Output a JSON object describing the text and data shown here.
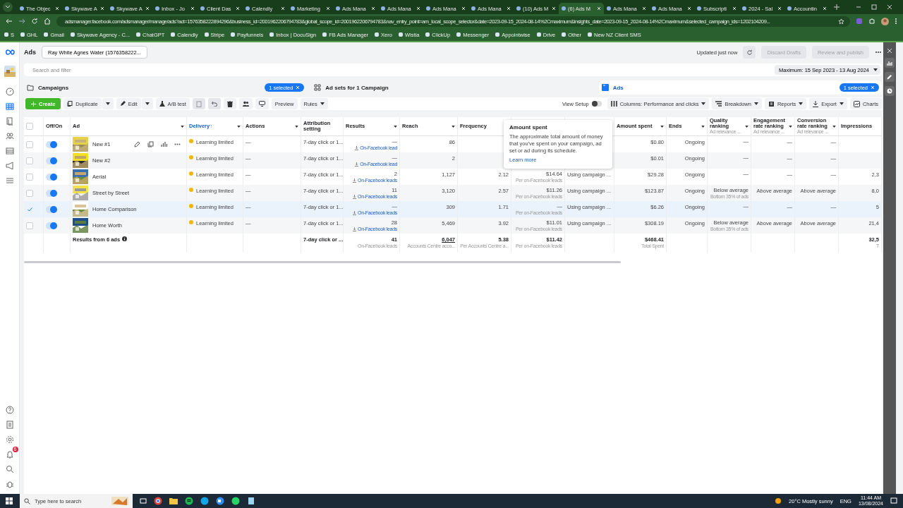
{
  "browser": {
    "tabs": [
      {
        "title": "The Objec",
        "selected": false
      },
      {
        "title": "Skywave A",
        "selected": false
      },
      {
        "title": "Skywave A",
        "selected": false
      },
      {
        "title": "Inbox - Jo",
        "selected": false
      },
      {
        "title": "Client Das",
        "selected": false
      },
      {
        "title": "Calendly",
        "selected": false
      },
      {
        "title": "Marketing",
        "selected": false
      },
      {
        "title": "Ads Mana",
        "selected": false
      },
      {
        "title": "Ads Mana",
        "selected": false
      },
      {
        "title": "Ads Mana",
        "selected": false
      },
      {
        "title": "Ads Mana",
        "selected": false
      },
      {
        "title": "(10) Ads M",
        "selected": false
      },
      {
        "title": "(6) Ads M",
        "selected": true
      },
      {
        "title": "Ads Mana",
        "selected": false
      },
      {
        "title": "Ads Mana",
        "selected": false
      },
      {
        "title": "Subscripti",
        "selected": false
      },
      {
        "title": "2024 - Sal",
        "selected": false
      },
      {
        "title": "Accountin",
        "selected": false
      }
    ],
    "url": "adsmanager.facebook.com/adsmanager/manage/ads?act=1576358222894296&business_id=2001962206794783&global_scope_id=2001962206794783&nav_entry_point=am_local_scope_selector&date=2023-09-15_2024-08-14%2Cmaximum&insights_date=2023-09-15_2024-08-14%2Cmaximum&selected_campaign_ids=1202104209...",
    "bookmarks": [
      "S",
      "GHL",
      "Gmail",
      "Skywave Agency - C...",
      "ChatGPT",
      "Calendly",
      "Stripe",
      "Payfunnels",
      "Inbox | DocuSign",
      "FB Ads Manager",
      "Xero",
      "Wistia",
      "ClickUp",
      "Messenger",
      "Appointwise",
      "Drive",
      "Other",
      "New NZ Client SMS"
    ]
  },
  "app": {
    "title": "Ads",
    "account": "Ray White Agnes Water (1576358222...",
    "status": "Updated just now",
    "actions": [
      {
        "label": "Discard Drafts",
        "disabled": true
      },
      {
        "label": "Review and publish",
        "disabled": true
      }
    ],
    "search": {
      "placeholder": "Search and filter"
    },
    "date_range": "Maximum: 15 Sep 2023 - 13 Aug 2024",
    "notification_count": "6"
  },
  "level_tabs": [
    {
      "label": "Campaigns",
      "selected": false,
      "badge": "1 selected"
    },
    {
      "label": "Ad sets for 1 Campaign",
      "selected": false
    },
    {
      "label": "Ads",
      "selected": true,
      "badge": "1 selected"
    }
  ],
  "toolbar": {
    "create": "Create",
    "duplicate": "Duplicate",
    "edit": "Edit",
    "ab_test": "A/B test",
    "preview": "Preview",
    "rules": "Rules",
    "view_setup": {
      "label": "View Setup",
      "on": false
    },
    "columns": "Columns: Performance and clicks",
    "breakdown": "Breakdown",
    "reports": "Reports",
    "export": "Export",
    "charts": "Charts"
  },
  "table": {
    "all_checked": false,
    "columns": [
      {
        "label": "Off/On",
        "menu": false,
        "sorted": false
      },
      {
        "label": "Ad",
        "menu": true,
        "sorted": false
      },
      {
        "label": "Delivery",
        "arrow": "↑",
        "menu": true,
        "sorted": true
      },
      {
        "label": "Actions",
        "menu": true,
        "sorted": false
      },
      {
        "label": "Attribution setting",
        "menu": false,
        "sorted": false
      },
      {
        "label": "Results",
        "menu": true,
        "sorted": false
      },
      {
        "label": "Reach",
        "menu": true,
        "sorted": false
      },
      {
        "label": "Frequency",
        "menu": false,
        "sorted": false
      },
      {},
      {},
      {
        "label": "Amount spent",
        "menu": true,
        "sorted": false
      },
      {
        "label": "Ends",
        "menu": true,
        "sorted": false
      },
      {
        "label": "Quality ranking",
        "sub": "Ad relevance ...",
        "menu": true,
        "sorted": false
      },
      {
        "label": "Engagement rate ranking",
        "sub": "Ad relevance ...",
        "menu": true,
        "sorted": false
      },
      {
        "label": "Conversion rate ranking",
        "sub": "Ad relevance ...",
        "menu": true,
        "sorted": false
      },
      {
        "label": "Impressions",
        "menu": false,
        "sorted": false
      }
    ],
    "rows": [
      {
        "checked": false,
        "on": true,
        "hovered": true,
        "name": "New #1",
        "delivery": "Learning limited",
        "color": "#f2b705",
        "actions": "—",
        "attribution": "7-day click or 1...",
        "results": {
          "value": "—",
          "sub": "On-Facebook lead"
        },
        "reach": "86",
        "amount": "$0.80",
        "ends": "Ongoing",
        "quality": {
          "value": "—"
        },
        "engagement": "—",
        "conversion": "—"
      },
      {
        "checked": false,
        "on": true,
        "hovered": false,
        "name": "New #2",
        "delivery": "Learning limited",
        "color": "#f2b705",
        "actions": "—",
        "attribution": "7-day click or 1...",
        "results": {
          "value": "—",
          "sub": "On-Facebook lead"
        },
        "reach": "2",
        "amount": "$0.01",
        "ends": "Ongoing",
        "quality": {
          "value": "—"
        },
        "engagement": "—",
        "conversion": "—"
      },
      {
        "checked": false,
        "on": true,
        "hovered": false,
        "name": "Aerial",
        "delivery": "Learning limited",
        "color": "#f2b705",
        "actions": "—",
        "attribution": "7-day click or 1...",
        "results": {
          "value": "2",
          "sub": "On-Facebook leads"
        },
        "reach": "1,127",
        "frequency": "2.12",
        "cost": {
          "value": "$14.64",
          "sub": "Per on-Facebook leads"
        },
        "bid": "Using campaign ...",
        "amount": "$29.28",
        "ends": "Ongoing",
        "quality": {
          "value": "—"
        },
        "engagement": "—",
        "conversion": "—",
        "impressions": "2,3"
      },
      {
        "checked": false,
        "on": true,
        "hovered": false,
        "name": "Street by Street",
        "delivery": "Learning limited",
        "color": "#f2b705",
        "actions": "—",
        "attribution": "7-day click or 1...",
        "results": {
          "value": "11",
          "sub": "On-Facebook leads"
        },
        "reach": "3,120",
        "frequency": "2.57",
        "cost": {
          "value": "$11.26",
          "sub": "Per on-Facebook leads"
        },
        "bid": "Using campaign ...",
        "amount": "$123.87",
        "ends": "Ongoing",
        "quality": {
          "value": "Below average",
          "sub": "Bottom 35% of ads"
        },
        "engagement": "Above average",
        "conversion": "Above average",
        "impressions": "8,0"
      },
      {
        "checked": true,
        "on": true,
        "hovered": false,
        "name": "Home Comparison",
        "delivery": "Learning limited",
        "color": "#f2b705",
        "actions": "—",
        "attribution": "7-day click or 1...",
        "results": {
          "value": "—",
          "sub": "On-Facebook leads"
        },
        "reach": "309",
        "frequency": "1.71",
        "cost": {
          "value": "—",
          "sub": "Per on-Facebook leads"
        },
        "bid": "Using campaign ...",
        "amount": "$6.26",
        "ends": "Ongoing",
        "quality": {
          "value": "—"
        },
        "engagement": "—",
        "conversion": "—",
        "impressions": "5"
      },
      {
        "checked": false,
        "on": true,
        "hovered": false,
        "name": "Home Worth",
        "delivery": "Learning limited",
        "color": "#f2b705",
        "actions": "—",
        "attribution": "7-day click or 1...",
        "results": {
          "value": "28",
          "sub": "On-Facebook leads"
        },
        "reach": "5,469",
        "frequency": "3.92",
        "cost": {
          "value": "$11.01",
          "sub": "Per on-Facebook leads"
        },
        "bid": "Using campaign ...",
        "amount": "$308.19",
        "ends": "Ongoing",
        "quality": {
          "value": "Below average",
          "sub": "Bottom 35% of ads"
        },
        "engagement": "Above average",
        "conversion": "Above average",
        "impressions": "21,4"
      }
    ],
    "footer": {
      "label": "Results from 6 ads",
      "attribution": "7-day click or ...",
      "results": {
        "value": "41",
        "sub": "On-Facebook leads"
      },
      "reach": {
        "value": "6,047",
        "sub": "Accounts Centre acco..."
      },
      "frequency": {
        "value": "5.38",
        "sub": "Per Accounts Centre a..."
      },
      "cost": {
        "value": "$11.42",
        "sub": "Per on-Facebook leads"
      },
      "amount": {
        "value": "$468.41",
        "sub": "Total Spent"
      },
      "impressions": {
        "value": "32,5",
        "sub": "T"
      }
    }
  },
  "tooltip": {
    "title": "Amount spent",
    "body": "The approximate total amount of money that you've spent on your campaign, ad set or ad during its schedule.",
    "link": "Learn more"
  },
  "taskbar": {
    "search_placeholder": "Type here to search",
    "weather": "20°C Mostly sunny",
    "language": "ENG",
    "time": "11:44 AM",
    "date": "13/08/2024"
  }
}
